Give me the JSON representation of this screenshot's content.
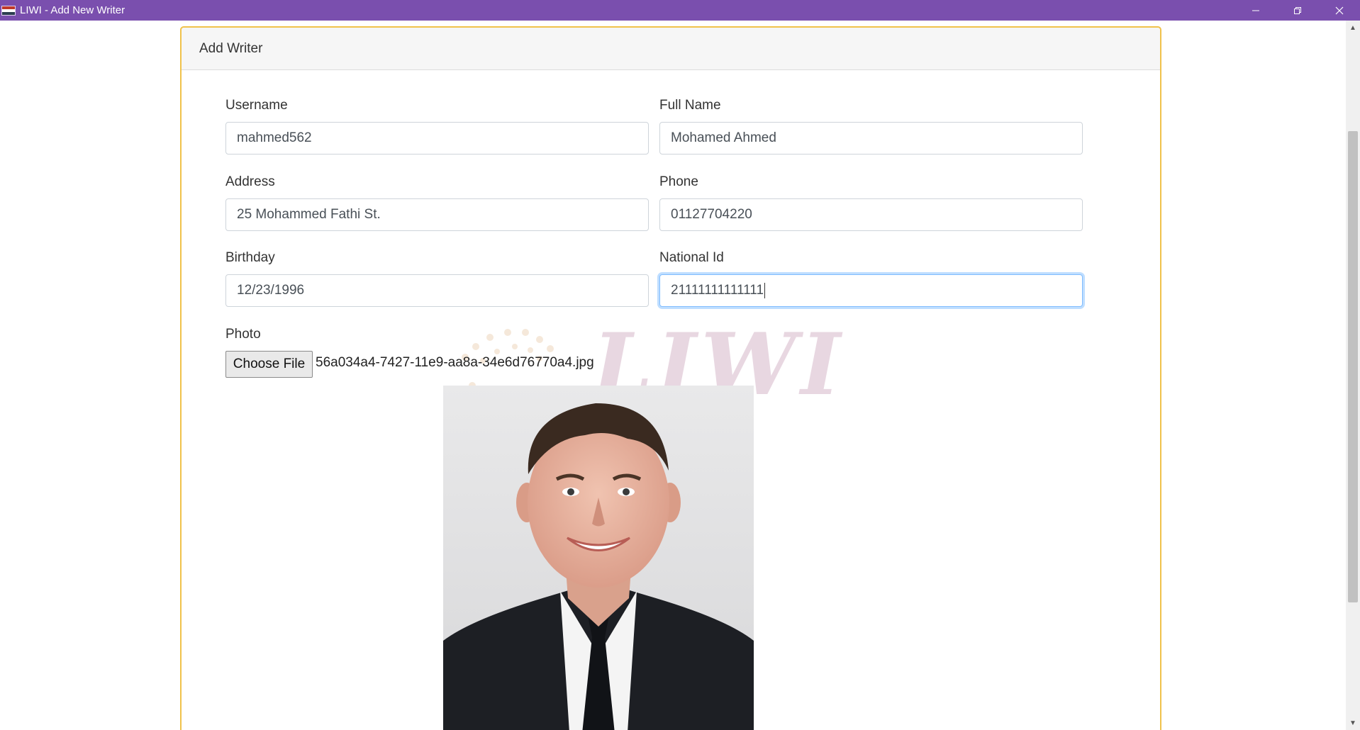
{
  "window": {
    "title": "LIWI - Add New Writer",
    "icons": {
      "app": "flag-icon",
      "minimize": "minimize-icon",
      "restore": "restore-icon",
      "close": "close-icon"
    }
  },
  "card": {
    "header": "Add Writer"
  },
  "form": {
    "username": {
      "label": "Username",
      "value": "mahmed562"
    },
    "full_name": {
      "label": "Full Name",
      "value": "Mohamed Ahmed"
    },
    "address": {
      "label": "Address",
      "value": "25 Mohammed Fathi St."
    },
    "phone": {
      "label": "Phone",
      "value": "01127704220"
    },
    "birthday": {
      "label": "Birthday",
      "value": "12/23/1996"
    },
    "national_id": {
      "label": "National Id",
      "value": "21111111111111"
    },
    "photo": {
      "label": "Photo",
      "button": "Choose File",
      "file_name": "56a034a4-7427-11e9-aa8a-34e6d76770a4.jpg"
    }
  },
  "watermark": {
    "text": "LIWI"
  },
  "colors": {
    "titlebar": "#7a4fae",
    "card_border": "#f0c24b",
    "focus": "#80bdff"
  }
}
